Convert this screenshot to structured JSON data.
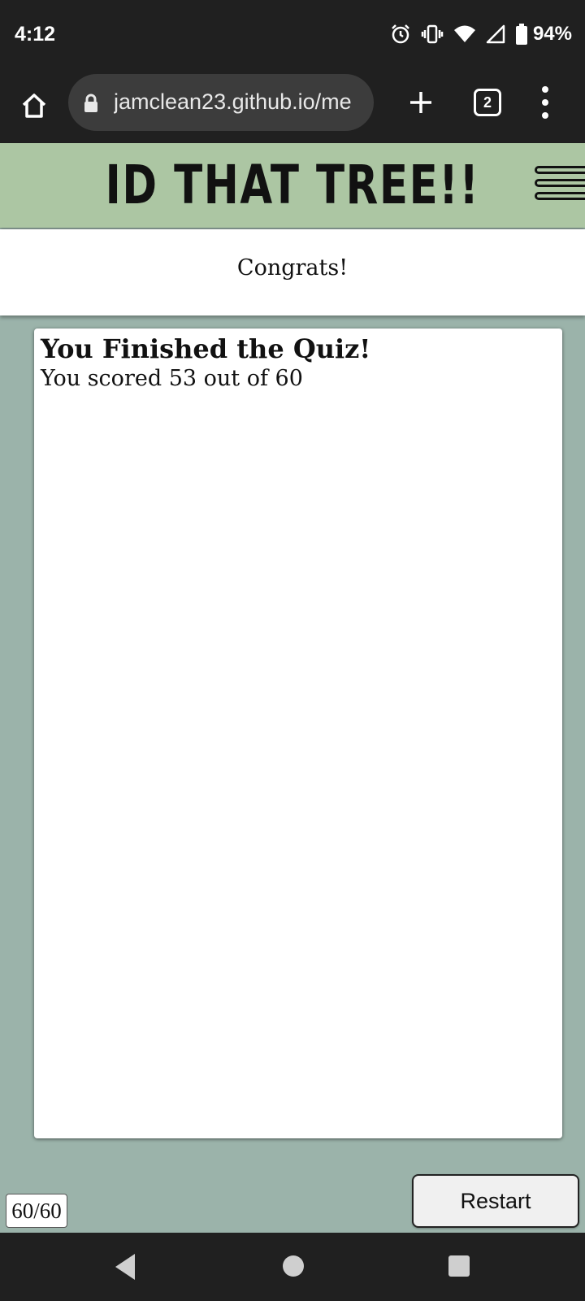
{
  "status_bar": {
    "time": "4:12",
    "battery": "94%",
    "icons": [
      "alarm-icon",
      "vibrate-icon",
      "wifi-icon",
      "signal-icon",
      "battery-icon"
    ]
  },
  "browser": {
    "url": "jamclean23.github.io/me",
    "tab_count": "2",
    "icons": [
      "home-icon",
      "lock-icon",
      "plus-icon",
      "more-vert-icon"
    ]
  },
  "site": {
    "title": "ID THAT TREE!!",
    "menu_icon": "hamburger-icon"
  },
  "banner": {
    "message": "Congrats!"
  },
  "quiz": {
    "heading": "You Finished the Quiz!",
    "score_text": "You scored 53 out of 60"
  },
  "controls": {
    "counter": "60/60",
    "restart_label": "Restart"
  },
  "colors": {
    "header_bg": "#acc6a3",
    "page_bg": "#9bb3aa",
    "system_bars": "#202020"
  }
}
